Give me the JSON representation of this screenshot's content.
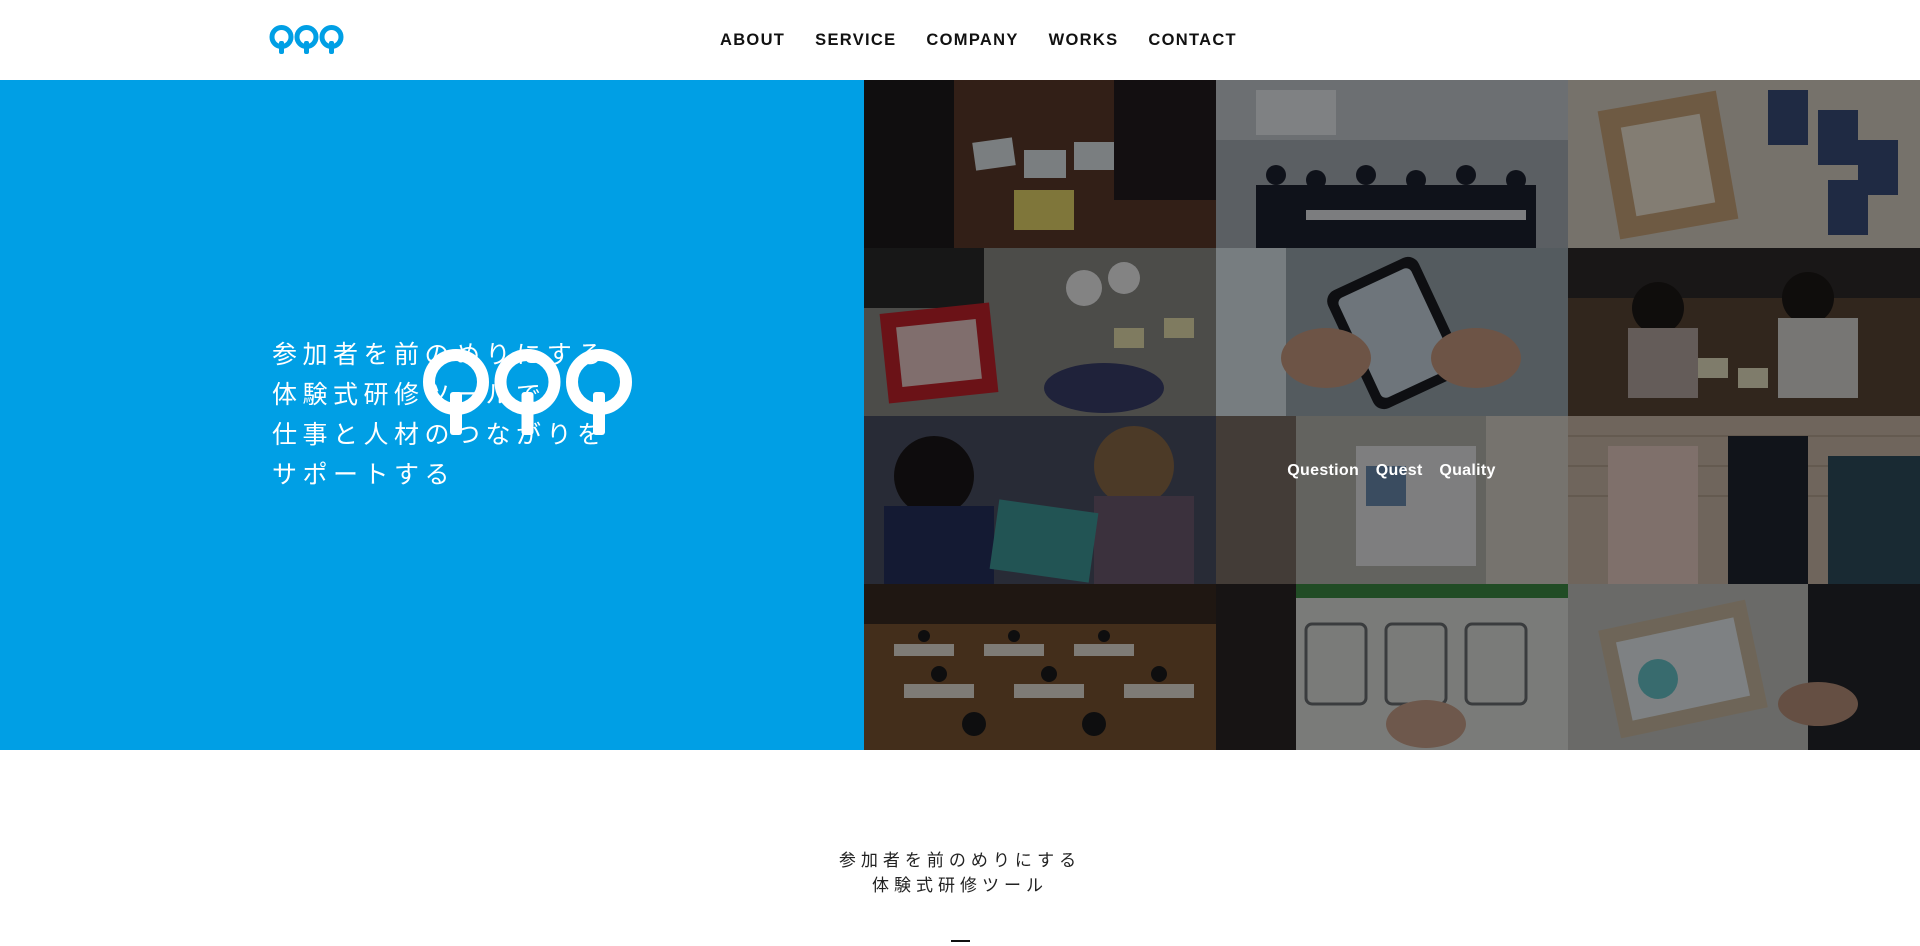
{
  "brand": {
    "name": "QQQ",
    "tagline_words": [
      "Question",
      "Quest",
      "Quality"
    ],
    "primary_color": "#009fe5"
  },
  "nav": {
    "items": [
      {
        "label": "ABOUT"
      },
      {
        "label": "SERVICE"
      },
      {
        "label": "COMPANY"
      },
      {
        "label": "WORKS"
      },
      {
        "label": "CONTACT"
      }
    ]
  },
  "hero": {
    "copy_lines": [
      "参加者を前のめりにする",
      "体験式研修ツールで",
      "仕事と人材のつながりを",
      "サポートする"
    ],
    "tagline": "Question Quest Quality",
    "photo_grid": {
      "columns": 3,
      "rows": 4,
      "tiles": [
        {
          "icon": "photo-cards-on-table"
        },
        {
          "icon": "photo-seminar-room"
        },
        {
          "icon": "photo-card-game"
        },
        {
          "icon": "photo-table-workshop"
        },
        {
          "icon": "photo-smartphone"
        },
        {
          "icon": "photo-group-work"
        },
        {
          "icon": "photo-participants"
        },
        {
          "icon": "photo-tablet-quiz"
        },
        {
          "icon": "photo-discussion"
        },
        {
          "icon": "photo-large-hall"
        },
        {
          "icon": "photo-board-sheet"
        },
        {
          "icon": "photo-tablet-board"
        }
      ]
    }
  },
  "intro": {
    "lines": [
      "参加者を前のめりにする",
      "体験式研修ツール"
    ]
  }
}
